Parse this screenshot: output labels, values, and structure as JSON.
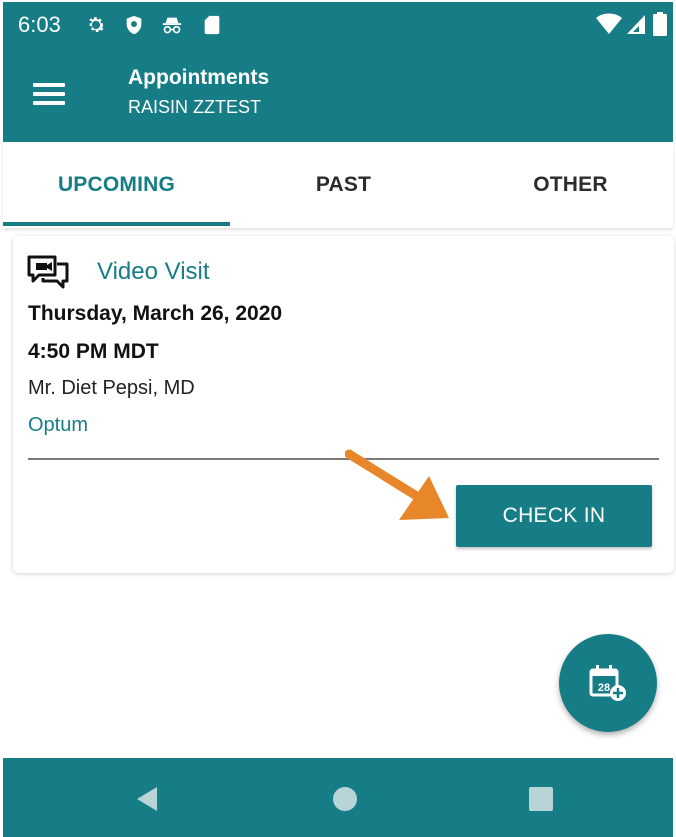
{
  "status_bar": {
    "time": "6:03",
    "icons": [
      "settings-icon",
      "shield-icon",
      "incognito-icon",
      "sd-card-icon",
      "wifi-icon",
      "cell-signal-icon",
      "battery-icon"
    ]
  },
  "app_bar": {
    "title": "Appointments",
    "subtitle": "RAISIN ZZTEST",
    "menu_icon": "hamburger-menu-icon"
  },
  "tabs": [
    {
      "label": "UPCOMING",
      "active": true
    },
    {
      "label": "PAST",
      "active": false
    },
    {
      "label": "OTHER",
      "active": false
    }
  ],
  "appointment": {
    "icon": "video-chat-icon",
    "type": "Video Visit",
    "date": "Thursday, March 26, 2020",
    "time": "4:50 PM MDT",
    "provider": "Mr. Diet Pepsi, MD",
    "organization": "Optum",
    "action_label": "CHECK IN"
  },
  "fab": {
    "icon": "calendar-add-icon",
    "calendar_day": "28"
  },
  "nav_bar": {
    "icons": [
      "back-icon",
      "home-icon",
      "recents-icon"
    ]
  },
  "colors": {
    "primary": "#167d87",
    "accent_arrow": "#e8862a",
    "white": "#ffffff"
  }
}
